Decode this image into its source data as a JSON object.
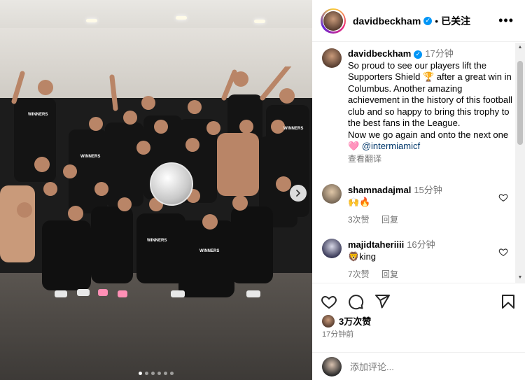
{
  "post": {
    "username": "davidbeckham",
    "follow_state": "已关注",
    "caption": {
      "username": "davidbeckham",
      "time": "17分钟",
      "text": "So proud to see our players lift the Supporters Shield 🏆 after a great win in Columbus. Another amazing achievement in the history of this football club and so happy to bring this trophy to the best fans in the League.\nNow we go again and onto the next one 🩷 ",
      "mention": "@intermiamicf",
      "see_translation": "查看翻译"
    },
    "comments": [
      {
        "username": "shamnadajmal",
        "time": "15分钟",
        "text": "🙌🔥",
        "likes": "3次赞",
        "reply": "回复"
      },
      {
        "username": "majidtaheriiii",
        "time": "16分钟",
        "text": "🦁king",
        "likes": "7次赞",
        "reply": "回复"
      }
    ],
    "likes": "3万次赞",
    "posted_time": "17分钟前",
    "add_comment_placeholder": "添加评论..."
  },
  "photo": {
    "carousel_dots": 6,
    "active_dot": 0
  },
  "icons": {
    "like": "heart-icon",
    "comment": "comment-icon",
    "share": "paper-plane-icon",
    "save": "bookmark-icon",
    "more": "more-dots-icon",
    "next": "chevron-right-icon"
  },
  "colors": {
    "verified": "#0095f6",
    "mention": "#00376b",
    "secondary_text": "#737373"
  }
}
